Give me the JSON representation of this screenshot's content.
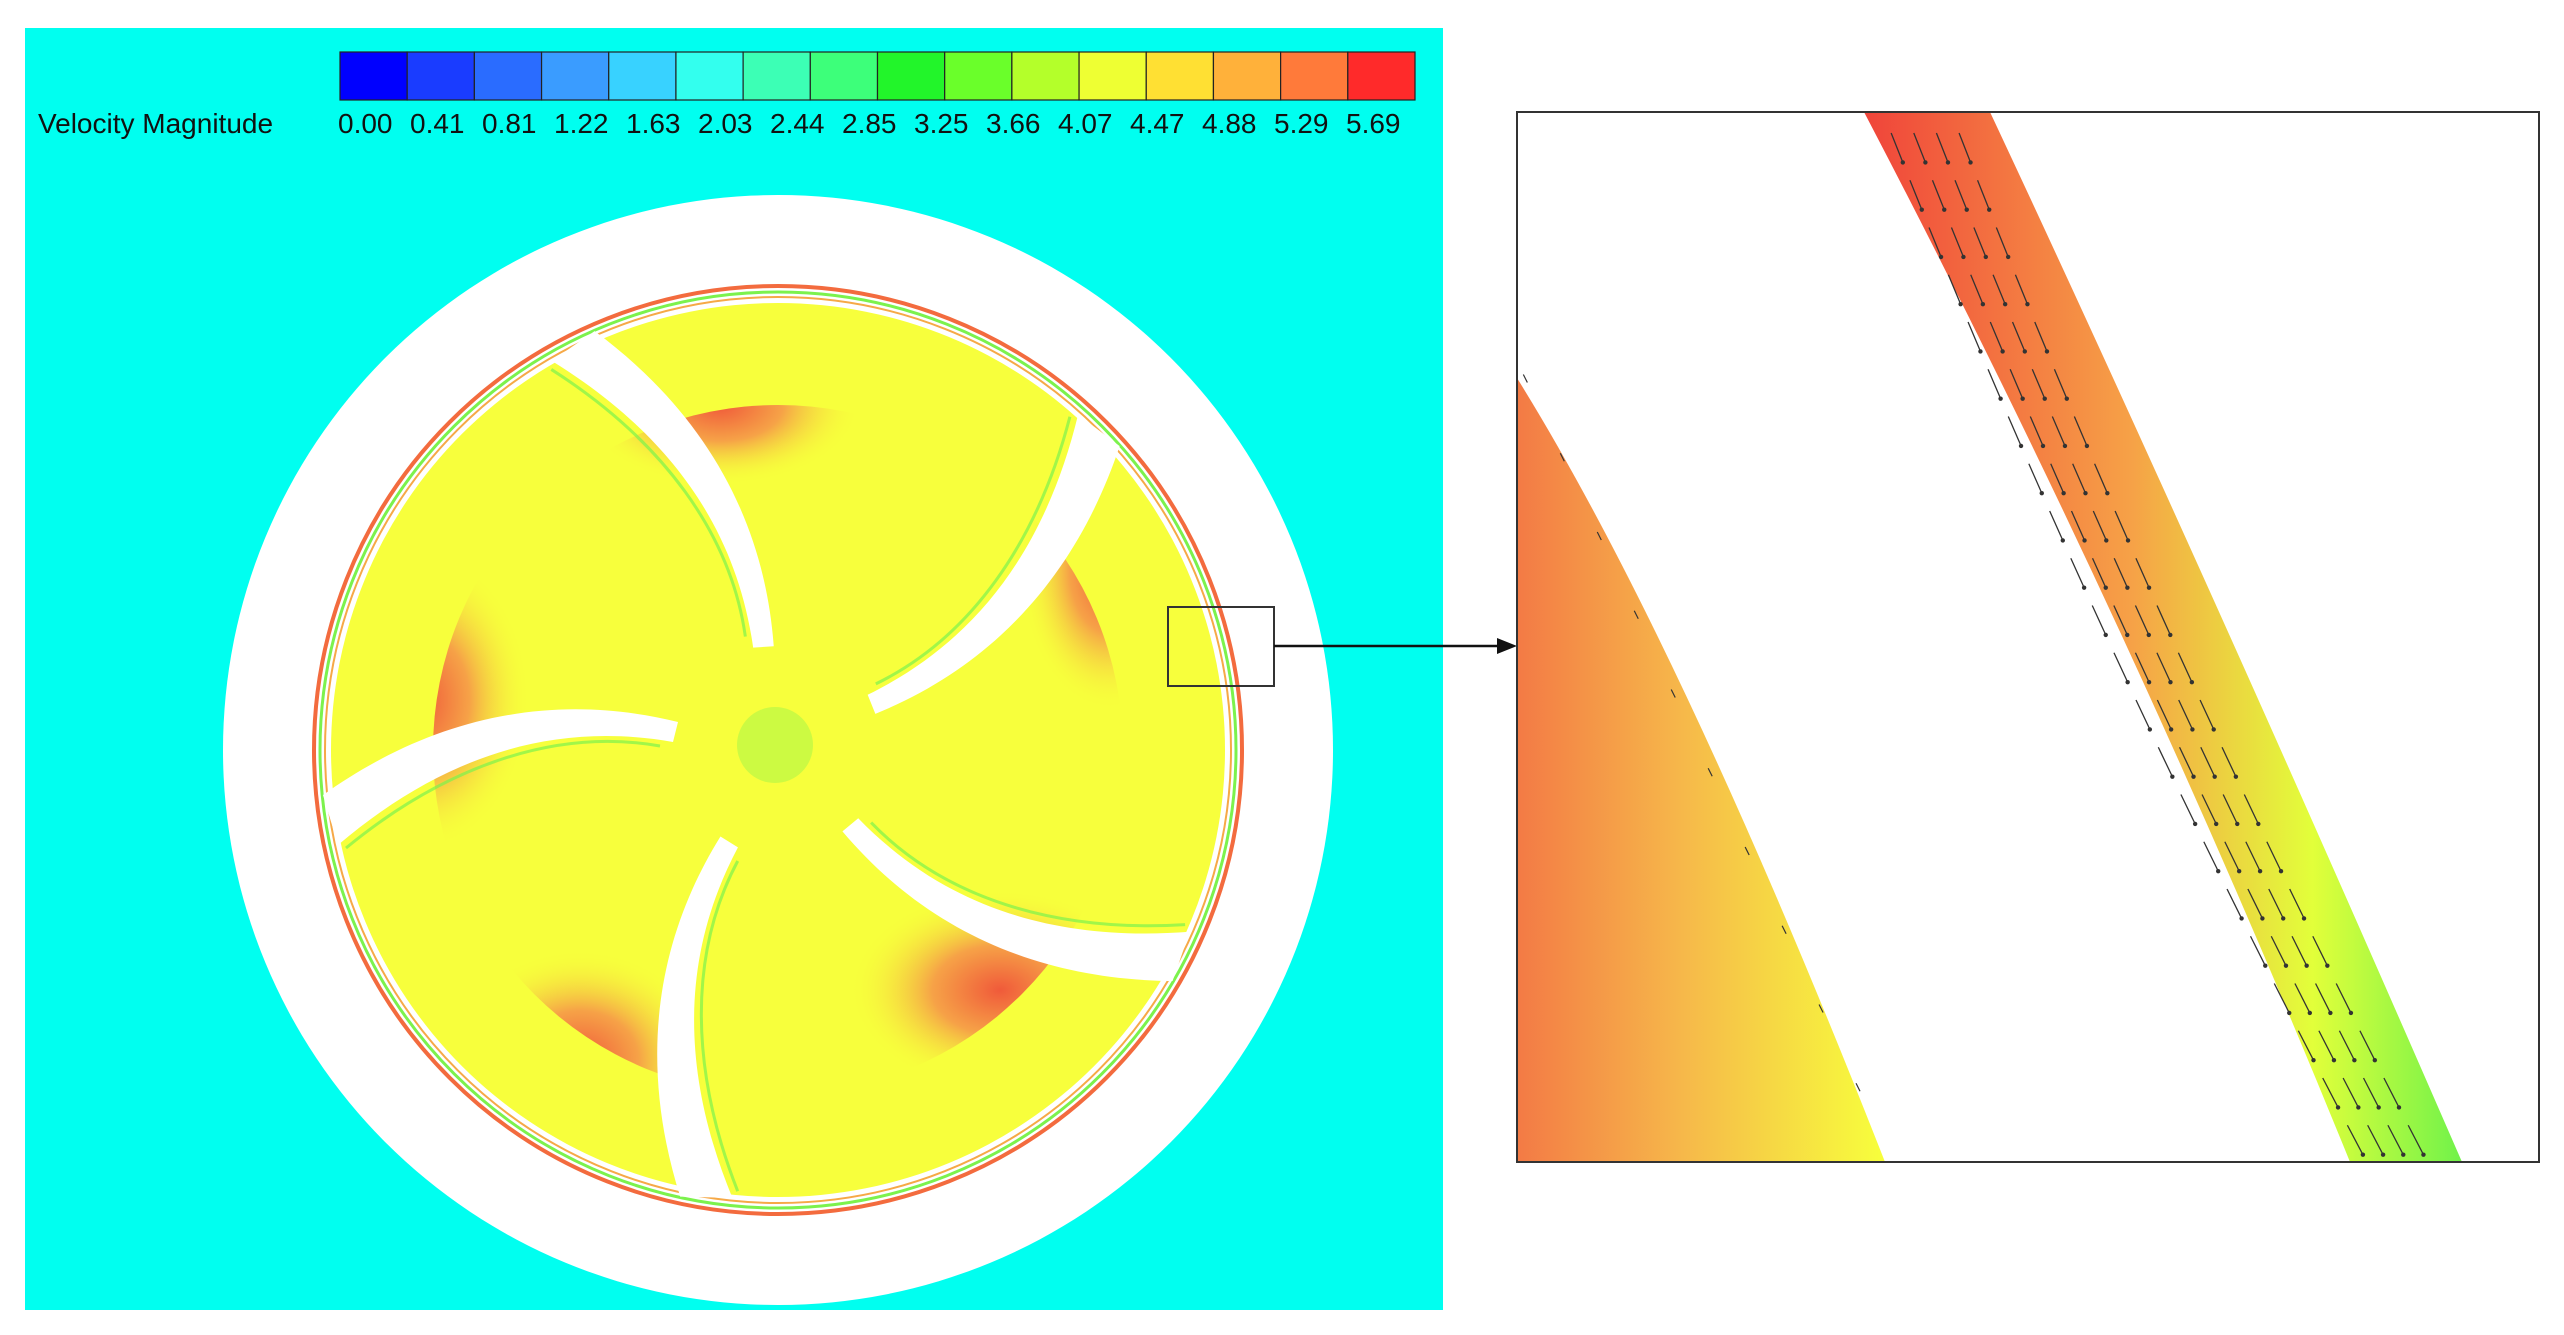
{
  "colorbar": {
    "title": "Velocity Magnitude",
    "tick_labels": [
      "0.00",
      "0.41",
      "0.81",
      "1.22",
      "1.63",
      "2.03",
      "2.44",
      "2.85",
      "3.25",
      "3.66",
      "4.07",
      "4.47",
      "4.88",
      "5.29",
      "5.69"
    ],
    "colors": [
      "#0000ff",
      "#1a3cff",
      "#2a6cff",
      "#3a9cff",
      "#38d2ff",
      "#33ffee",
      "#3cffb5",
      "#3dff7a",
      "#22f52a",
      "#6aff2a",
      "#b4ff2a",
      "#eeff33",
      "#ffe033",
      "#ffb13a",
      "#ff7a3a",
      "#ff2a2a"
    ]
  },
  "field_colors": {
    "background": "#00fff0",
    "solid": "#ffffff",
    "bulk_flow": "#f7ff3c",
    "high_velocity": "#f36b3e",
    "medium_velocity": "#f6a947",
    "low_velocity": "#7cf24d",
    "arrow": "#333333",
    "frame": "#333333"
  },
  "impeller": {
    "blade_count": 5,
    "rotation": "counter-clockwise"
  },
  "zoom_inset": {
    "arrow_direction": "right"
  }
}
